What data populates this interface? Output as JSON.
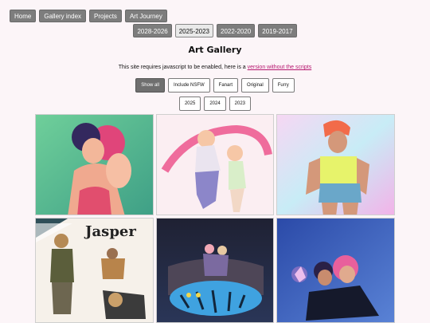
{
  "nav": {
    "home": "Home",
    "gallery_index": "Gallery index",
    "projects": "Projects",
    "art_journey": "Art Journey"
  },
  "eras": [
    "2028-2026",
    "2025-2023",
    "2022-2020",
    "2019-2017"
  ],
  "active_era": "2025-2023",
  "page_title": "Art Gallery",
  "notice": {
    "text": "This site requires javascript to be enabled, here is a",
    "link": "version without the scripts"
  },
  "filters": [
    "Show all",
    "Include NSFW",
    "Fanart",
    "Original",
    "Furry"
  ],
  "active_filter": "Show all",
  "years": [
    "2025",
    "2024",
    "2023"
  ],
  "gallery": {
    "jasper_title": "Jasper"
  },
  "colors": {
    "background": "#fcf5f8",
    "nav_button": "#7d7d7d",
    "link": "#b6166f"
  }
}
